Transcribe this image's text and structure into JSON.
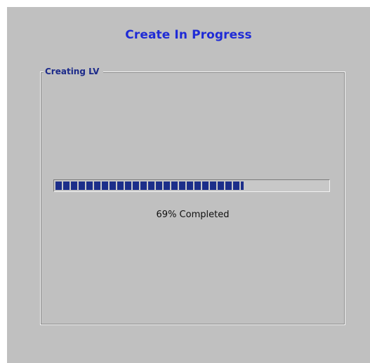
{
  "dialog": {
    "title": "Create In Progress"
  },
  "group": {
    "label": "Creating LV"
  },
  "progress": {
    "percent": 69,
    "status_text": "69% Completed"
  },
  "colors": {
    "title": "#1f2bd6",
    "progress_fill": "#1c2e8a",
    "background": "#c0c0c0"
  }
}
